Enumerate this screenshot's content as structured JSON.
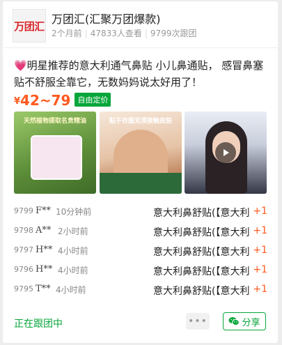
{
  "group": {
    "logo_text": "万团汇",
    "title": "万团汇(汇聚万团爆款)",
    "posted": "2个月前",
    "views": "47833人查看",
    "followers": "9799次跟团"
  },
  "post": {
    "description": "💗明星推荐的意大利通气鼻贴 小儿鼻通贴， 感冒鼻塞贴不舒服全靠它，无数妈妈说太好用了！",
    "currency": "¥",
    "price_range": "42~79",
    "price_tag": "自由定价",
    "images": [
      {
        "banner": "天然植物提取名贵精油",
        "icon": "product-image"
      },
      {
        "banner": "贴于衣服无须接触皮肤",
        "icon": "child-image"
      },
      {
        "banner": "",
        "icon": "video-thumbnail"
      }
    ]
  },
  "orders": [
    {
      "num": "9799",
      "name": "F**",
      "time": "10分钟前",
      "product": "意大利鼻舒贴(【意大利",
      "count": "+1"
    },
    {
      "num": "9798",
      "name": "A**",
      "time": "2小时前",
      "product": "意大利鼻舒贴(【意大利",
      "count": "+1"
    },
    {
      "num": "9797",
      "name": "H**",
      "time": "4小时前",
      "product": "意大利鼻舒贴(【意大利",
      "count": "+1"
    },
    {
      "num": "9796",
      "name": "H**",
      "time": "4小时前",
      "product": "意大利鼻舒贴(【意大利",
      "count": "+1"
    },
    {
      "num": "9795",
      "name": "T**",
      "time": "4小时前",
      "product": "意大利鼻舒贴(【意大利",
      "count": "+1"
    }
  ],
  "footer": {
    "status": "正在跟团中",
    "more_label": "•••",
    "share_label": "分享"
  },
  "colors": {
    "accent": "#06a63a",
    "price": "#ff5a1f",
    "logo": "#d9252b"
  }
}
